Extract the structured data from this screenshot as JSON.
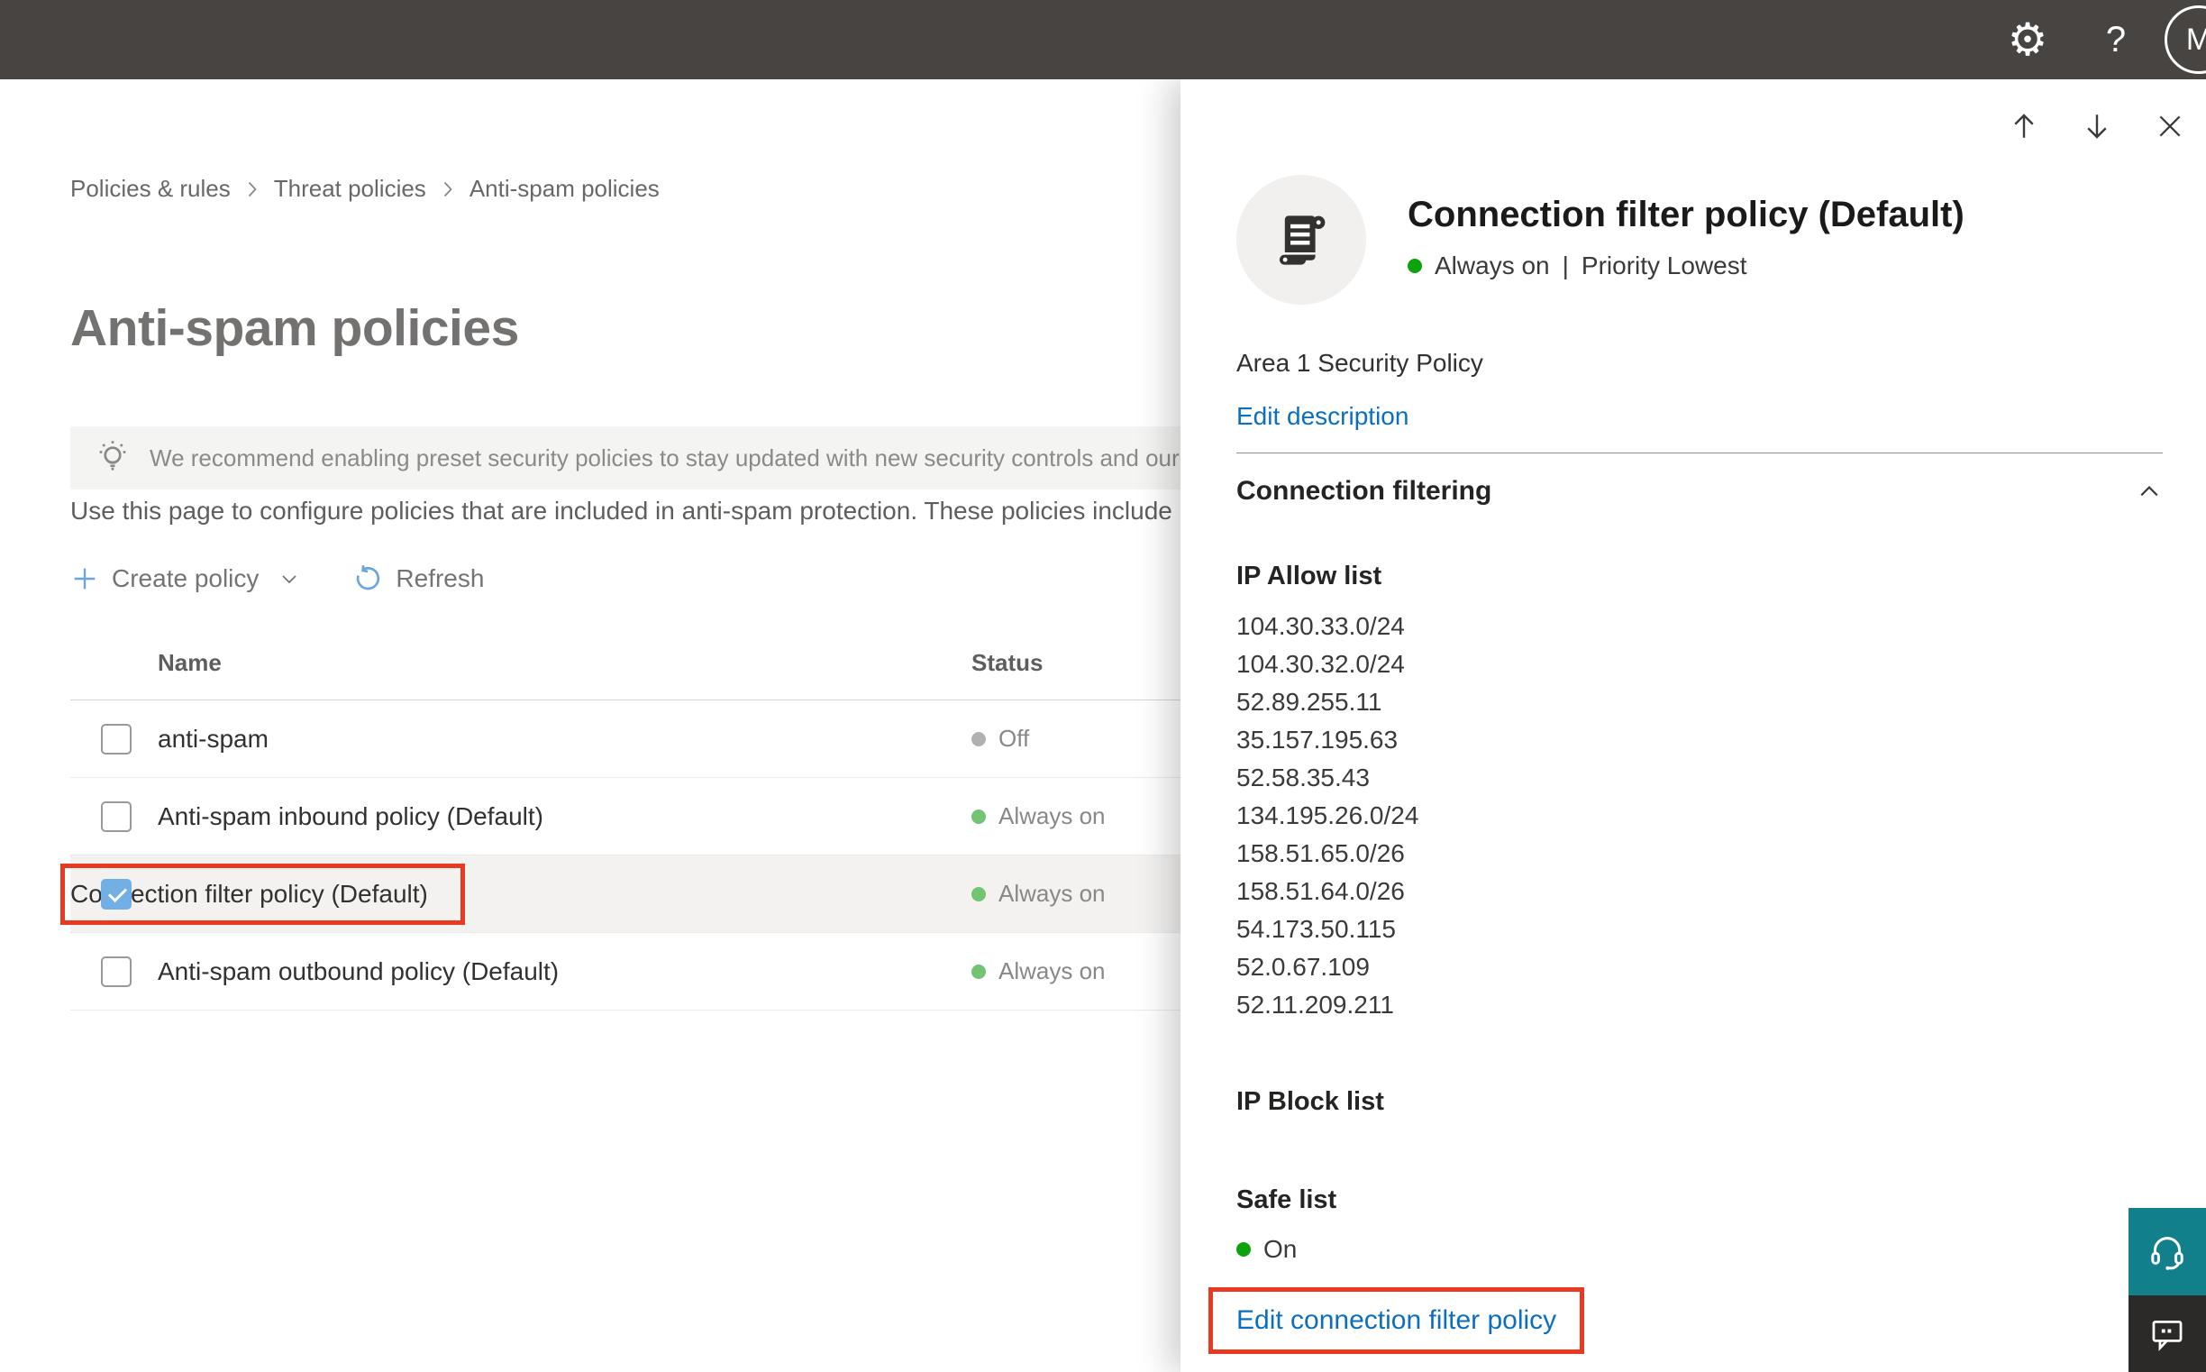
{
  "topbar": {
    "help_label": "?",
    "avatar_initial": "M",
    "settings_glyph": "⚙"
  },
  "breadcrumb": {
    "items": [
      "Policies & rules",
      "Threat policies",
      "Anti-spam policies"
    ]
  },
  "page": {
    "title": "Anti-spam policies",
    "banner_text": "We recommend enabling preset security policies to stay updated with new security controls and our recomme",
    "description": "Use this page to configure policies that are included in anti-spam protection. These policies include"
  },
  "toolbar": {
    "create_label": "Create policy",
    "refresh_label": "Refresh"
  },
  "table": {
    "name_header": "Name",
    "status_header": "Status",
    "rows": [
      {
        "name": "anti-spam",
        "status": "Off"
      },
      {
        "name": "Anti-spam inbound policy (Default)",
        "status": "Always on"
      },
      {
        "name": "Connection filter policy (Default)",
        "status": "Always on"
      },
      {
        "name": "Anti-spam outbound policy (Default)",
        "status": "Always on"
      }
    ]
  },
  "panel": {
    "title": "Connection filter policy (Default)",
    "status": "Always on",
    "status_separator": "|",
    "priority": "Priority Lowest",
    "description": "Area 1 Security Policy",
    "edit_description_label": "Edit description",
    "section_title": "Connection filtering",
    "ip_allow_title": "IP Allow list",
    "ip_allow_items": [
      "104.30.33.0/24",
      "104.30.32.0/24",
      "52.89.255.11",
      "35.157.195.63",
      "52.58.35.43",
      "134.195.26.0/24",
      "158.51.65.0/26",
      "158.51.64.0/26",
      "54.173.50.115",
      "52.0.67.109",
      "52.11.209.211"
    ],
    "ip_block_title": "IP Block list",
    "safe_list_title": "Safe list",
    "safe_list_status": "On",
    "edit_link_label": "Edit connection filter policy"
  },
  "colors": {
    "topbar_bg": "#474441",
    "accent_red": "#e83a21",
    "link_blue": "#0b6fc0",
    "checkbox_checked_blue": "#71afe5",
    "status_on_green_table": "#72c472",
    "status_on_green_panel": "#0ca30c",
    "status_off_gray": "#b3b1af",
    "toolbar_icon_blue": "#6ba5dd",
    "selected_row_bg": "#f3f2f1",
    "banner_bg": "#f4f4f3",
    "support_teal": "#12808a",
    "feedback_dark": "#2b2a28"
  },
  "icons": {
    "settings": "gear",
    "help": "question-mark",
    "avatar": "user-initial",
    "banner": "lightbulb",
    "create": "plus",
    "create_chevron": "chevron-down",
    "refresh": "circular-arrow",
    "policy": "scroll",
    "panel_up": "arrow-up",
    "panel_down": "arrow-down",
    "panel_close": "close-x",
    "section_chevron": "chevron-up",
    "support": "headset",
    "feedback": "speech-bubble"
  }
}
